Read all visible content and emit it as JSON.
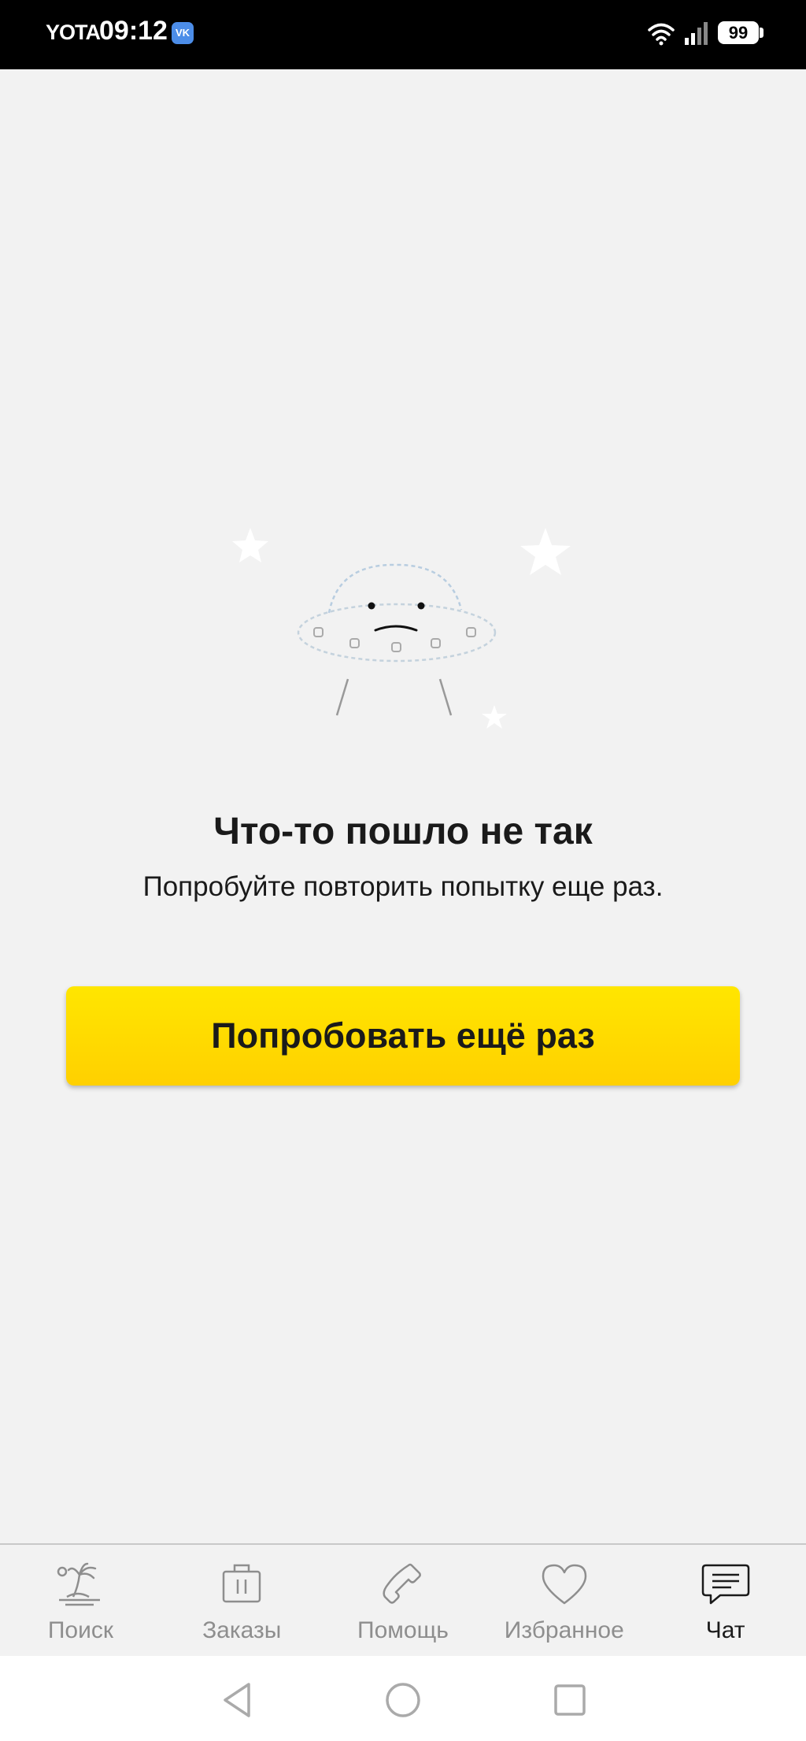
{
  "status_bar": {
    "carrier": "YOTA",
    "time": "09:12",
    "vk_badge": "VK",
    "battery": "99",
    "icons": [
      "vk-icon",
      "wifi-icon",
      "signal-icon",
      "battery-icon"
    ]
  },
  "error": {
    "illustration": "ufo-sad-face-icon",
    "title": "Что-то пошло не так",
    "subtitle": "Попробуйте повторить попытку еще раз.",
    "retry_label": "Попробовать ещё раз",
    "accent_color": "#ffdd00"
  },
  "tabs": [
    {
      "label": "Поиск",
      "icon": "palm-island-icon",
      "active": false
    },
    {
      "label": "Заказы",
      "icon": "suitcase-icon",
      "active": false
    },
    {
      "label": "Помощь",
      "icon": "phone-icon",
      "active": false
    },
    {
      "label": "Избранное",
      "icon": "heart-icon",
      "active": false
    },
    {
      "label": "Чат",
      "icon": "chat-icon",
      "active": true
    }
  ],
  "nav": {
    "icons": [
      "back-icon",
      "home-icon",
      "recents-icon"
    ]
  }
}
